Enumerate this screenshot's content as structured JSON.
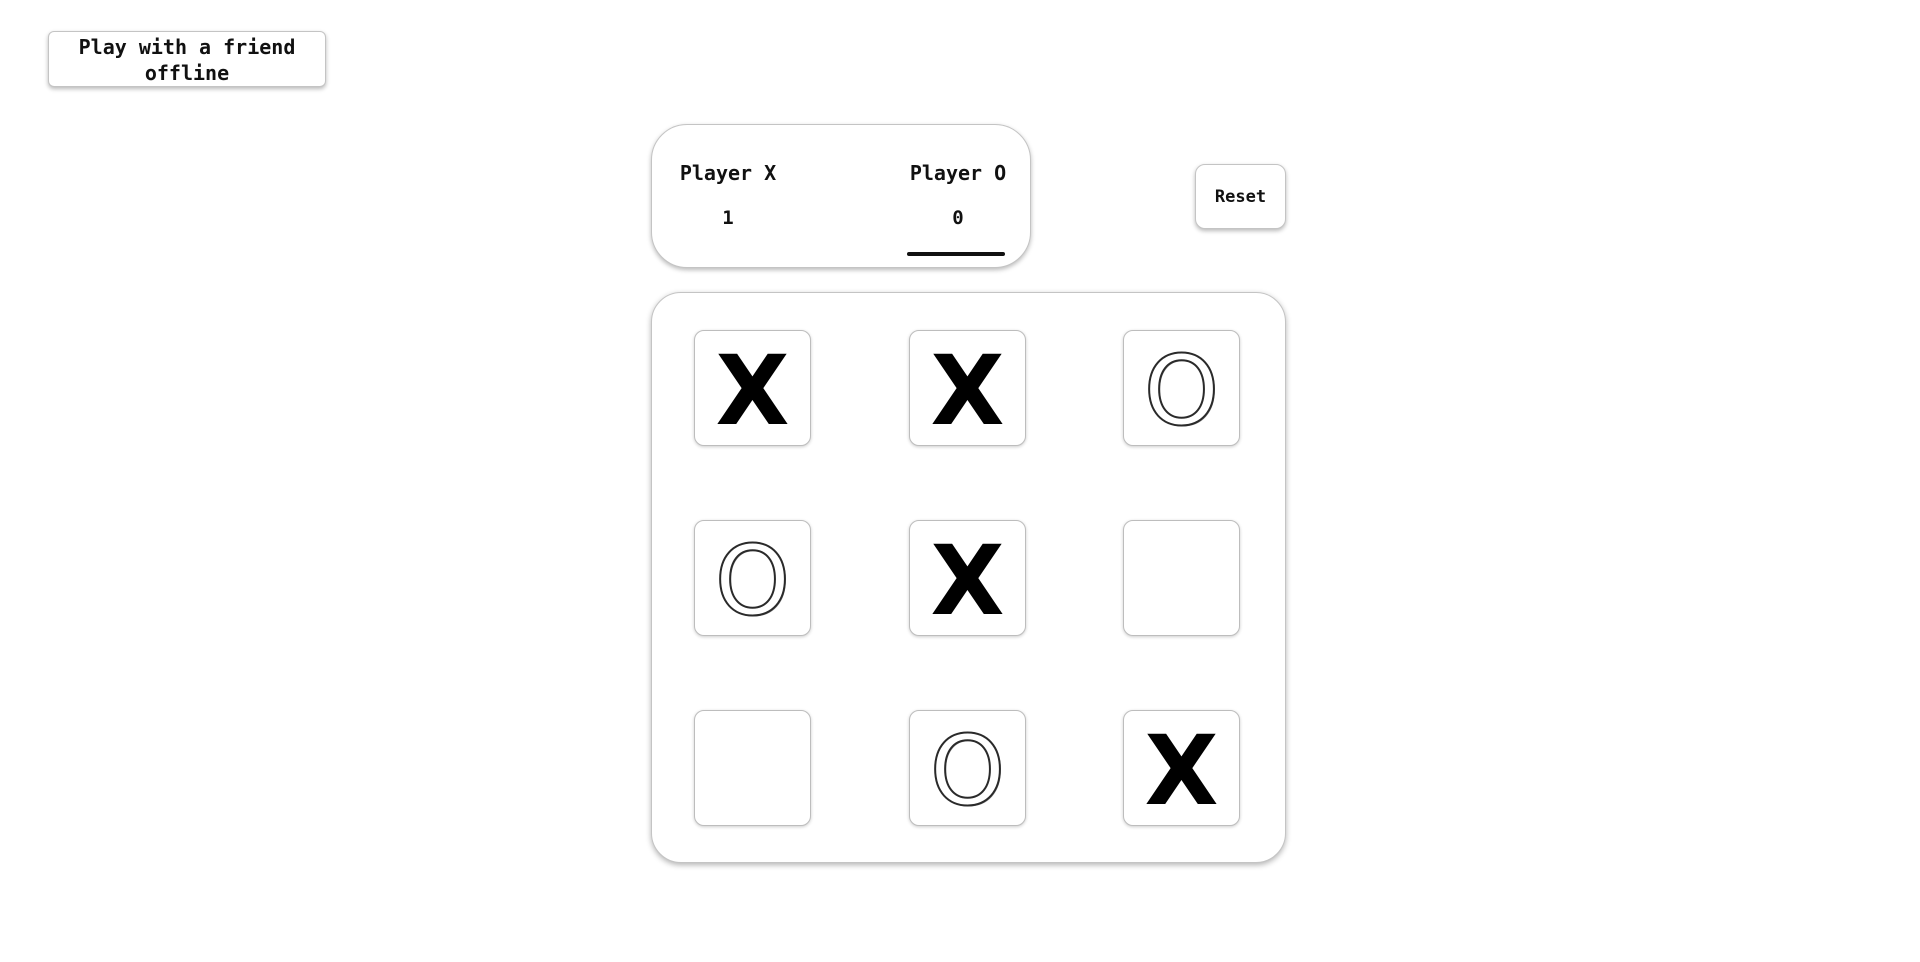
{
  "mode_button": {
    "label": "Play with a friend offline"
  },
  "scoreboard": {
    "player_x": {
      "label": "Player X",
      "score": "1"
    },
    "player_o": {
      "label": "Player O",
      "score": "0"
    },
    "current_turn": "O"
  },
  "reset_button": {
    "label": "Reset"
  },
  "board": {
    "cells": [
      "X",
      "X",
      "O",
      "O",
      "X",
      "",
      "",
      "O",
      "X"
    ]
  },
  "colors": {
    "background": "#ffffff",
    "text": "#111111",
    "border": "#c4c4c4"
  }
}
